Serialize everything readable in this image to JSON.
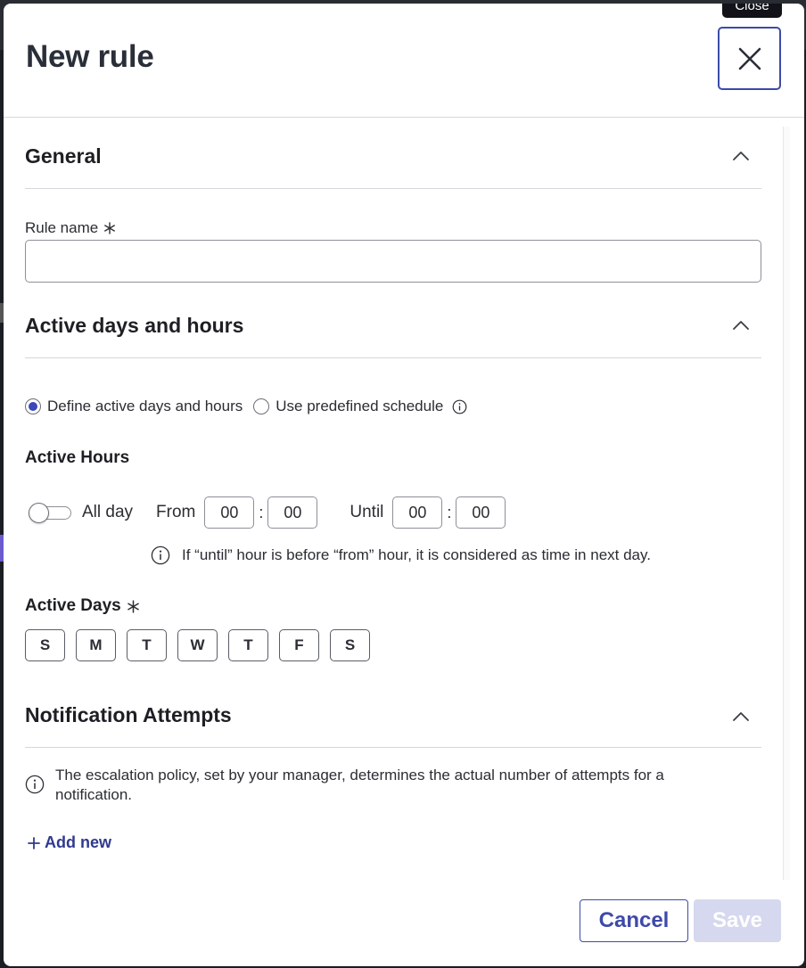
{
  "tooltip": {
    "text": "Close"
  },
  "dialog": {
    "title": "New rule",
    "close_icon": "close-icon"
  },
  "general": {
    "title": "General",
    "rule_name_label": "Rule name",
    "rule_name_value": "",
    "rule_name_placeholder": ""
  },
  "active_days_hours": {
    "title": "Active days and hours",
    "mode_options": [
      {
        "label": "Define active days and hours",
        "selected": true
      },
      {
        "label": "Use predefined schedule",
        "selected": false
      }
    ],
    "active_hours_heading": "Active Hours",
    "all_day_label": "All day",
    "all_day_enabled": false,
    "from_label": "From",
    "from_hour": "00",
    "from_minute": "00",
    "separator": ":",
    "until_label": "Until",
    "until_hour": "00",
    "until_minute": "00",
    "hint": "If “until” hour is before “from” hour, it is considered as time in next day.",
    "active_days_heading": "Active Days",
    "days": [
      "S",
      "M",
      "T",
      "W",
      "T",
      "F",
      "S"
    ]
  },
  "notification_attempts": {
    "title": "Notification Attempts",
    "note": "The escalation policy, set by your manager, determines the actual number of attempts for a notification.",
    "add_new_label": "Add new"
  },
  "footer": {
    "cancel_label": "Cancel",
    "save_label": "Save"
  },
  "colors": {
    "accent": "#3e4aa8",
    "disabled_button": "#d6d8ef",
    "link": "#2f3a8f"
  }
}
